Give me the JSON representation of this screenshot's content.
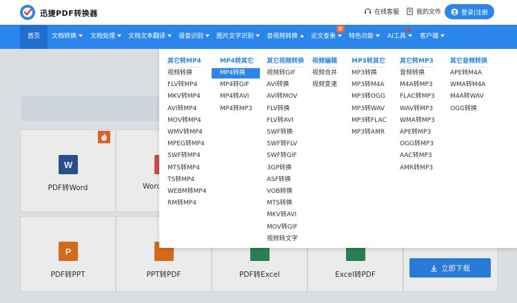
{
  "header": {
    "app_name": "迅捷PDF转换器",
    "online_service": "在线客服",
    "my_files": "我的文件",
    "login": "登录|注册"
  },
  "nav": [
    {
      "label": "首页"
    },
    {
      "label": "文档转换"
    },
    {
      "label": "文档处理"
    },
    {
      "label": "文档文本翻译"
    },
    {
      "label": "语音识别"
    },
    {
      "label": "图片文字识别"
    },
    {
      "label": "音视频转换"
    },
    {
      "label": "论文查重"
    },
    {
      "label": "特色功能"
    },
    {
      "label": "AI工具"
    },
    {
      "label": "客户端"
    }
  ],
  "new_badge": "新",
  "dropdown": {
    "columns": [
      {
        "title": "其它转MP4",
        "items": [
          "视频转换",
          "FLV转MP4",
          "MKV转MP4",
          "AVI转MP4",
          "MOV转MP4",
          "WMV转MP4",
          "MPEG转MP4",
          "SWF转MP4",
          "MTS转MP4",
          "TS转MP4",
          "WEBM转MP4",
          "RM转MP4"
        ]
      },
      {
        "title": "MP4转其它",
        "items": [
          "MP4转换",
          "MP4转GIF",
          "MP4转AVI",
          "MP4转MP3"
        ]
      },
      {
        "title": "其它视频转换",
        "items": [
          "视频转GIF",
          "AVI转换",
          "AVI转MOV",
          "FLV转换",
          "FLV转AVI",
          "SWF转换",
          "SWF转FLV",
          "SWF转GIF",
          "3GP转换",
          "ASF转换",
          "VOB转换",
          "MTS转换",
          "MKV转AVI",
          "MOV转GIF",
          "视频转文字"
        ]
      },
      {
        "title": "视频编辑",
        "items": [
          "视频合并",
          "视频变速"
        ]
      },
      {
        "title": "MP3转其它",
        "items": [
          "MP3转换",
          "MP3转M4A",
          "MP3转OGG",
          "MP3转WAV",
          "MP3转FLAC",
          "MP3转AMR"
        ]
      },
      {
        "title": "其它转MP3",
        "items": [
          "音频转换",
          "M4A转MP3",
          "FLAC转MP3",
          "WAV转MP3",
          "WMA转MP3",
          "APE转MP3",
          "OGG转MP3",
          "AAC转MP3",
          "AMR转MP3"
        ]
      },
      {
        "title": "其它音频转换",
        "items": [
          "APE转M4A",
          "WMA转M4A",
          "M4A转WAV",
          "OGG转换"
        ]
      }
    ],
    "selected": "MP4转换"
  },
  "cards": [
    {
      "label": "PDF转Word",
      "tile": "W",
      "color": "#2b5797"
    },
    {
      "label": "Word",
      "tile": "",
      "color": "#d9534f"
    },
    {
      "label": "PDF转PPT",
      "tile": "P",
      "color": "#e8731b"
    },
    {
      "label": "PPT转PDF",
      "tile": "",
      "color": "#e8731b"
    },
    {
      "label": "PDF转Excel",
      "tile": "",
      "color": "#2e8b57"
    },
    {
      "label": "Excel转PDF",
      "tile": "",
      "color": "#2e8b57"
    }
  ],
  "download_button": "立即下载"
}
